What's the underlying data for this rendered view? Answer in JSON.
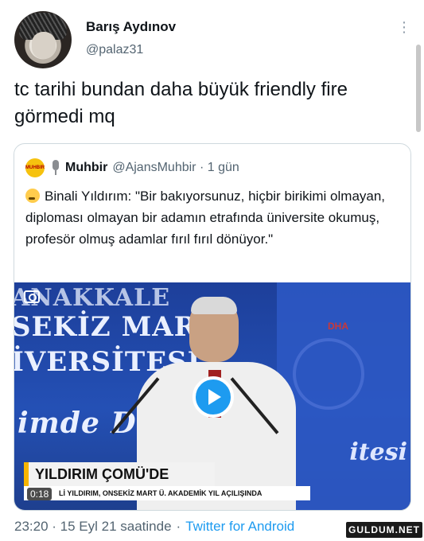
{
  "author": {
    "display_name": "Barış Aydınov",
    "handle": "@palaz31"
  },
  "tweet": {
    "text": "tc tarihi bundan daha büyük friendly fire görmedi mq",
    "timestamp": "23:20 · 15 Eyl 21 saatinde",
    "source": "Twitter for Android"
  },
  "quoted_tweet": {
    "display_name": "Muhbir",
    "handle": "@AjansMuhbir",
    "age": "1 gün",
    "avatar_text": "MUHBIR",
    "text": "Binali Yıldırım: \"Bir bakıyorsunuz, hiçbir birikimi olmayan, diploması olmayan bir adamın etrafında üniversite okumuş, profesör olmuş adamlar fırıl fırıl dönüyor.\"",
    "video": {
      "bg_line1": "ANAKKALE",
      "bg_line2": "SEKİZ MART",
      "bg_line3": "İVERSİTESİ",
      "bg_line4": "imde D",
      "bg_right_text": "itesi",
      "channel_logo": "DHA",
      "caption": "YILDIRIM ÇOMÜ'DE",
      "ticker": "Lİ YILDIRIM, ONSEKİZ MART Ü. AKADEMİK YIL AÇILIŞINDA",
      "time": "0:18"
    }
  },
  "watermark": "GULDUM.NET",
  "colors": {
    "accent": "#1d9bf0",
    "secondary_text": "#536471",
    "border": "#cfd9de"
  },
  "icons": [
    "more-icon",
    "mic-icon",
    "thinking-face-icon",
    "camera-icon",
    "play-icon"
  ]
}
